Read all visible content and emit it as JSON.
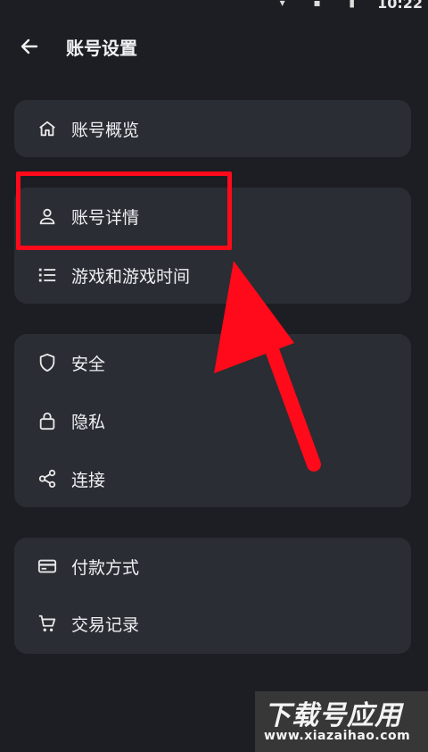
{
  "status": {
    "time": "10:22"
  },
  "header": {
    "title": "账号设置"
  },
  "groups": [
    {
      "items": [
        {
          "icon": "home-icon",
          "label": "账号概览"
        }
      ]
    },
    {
      "items": [
        {
          "icon": "user-icon",
          "label": "账号详情"
        },
        {
          "icon": "list-icon",
          "label": "游戏和游戏时间"
        }
      ]
    },
    {
      "items": [
        {
          "icon": "shield-icon",
          "label": "安全"
        },
        {
          "icon": "lock-icon",
          "label": "隐私"
        },
        {
          "icon": "share-icon",
          "label": "连接"
        }
      ]
    },
    {
      "items": [
        {
          "icon": "card-icon",
          "label": "付款方式"
        },
        {
          "icon": "cart-icon",
          "label": "交易记录"
        }
      ]
    }
  ],
  "annotation": {
    "color": "#ff0a1a",
    "target": "账号详情"
  },
  "watermark": {
    "title": "下载号应用",
    "url": "www.xiazaihao.com"
  },
  "colors": {
    "background": "#1c1e23",
    "card": "#2a2d33",
    "text": "#eef0f3"
  }
}
